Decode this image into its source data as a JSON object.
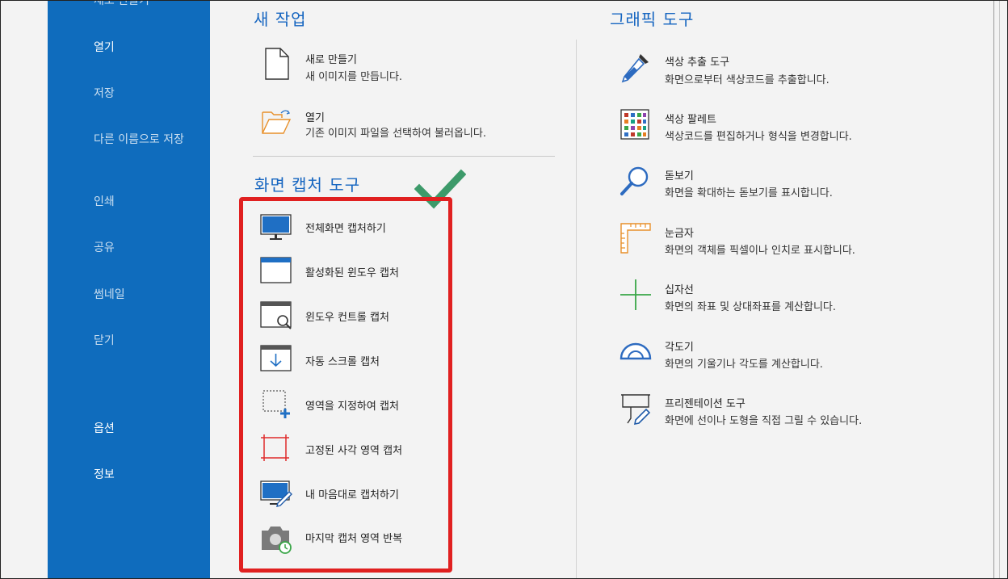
{
  "sidebar": {
    "items": [
      {
        "label": "새로 만들기"
      },
      {
        "label": "열기"
      },
      {
        "label": "저장"
      },
      {
        "label": "다른 이름으로 저장"
      },
      {
        "label": "인쇄"
      },
      {
        "label": "공유"
      },
      {
        "label": "썸네일"
      },
      {
        "label": "닫기"
      },
      {
        "label": "옵션"
      },
      {
        "label": "정보"
      }
    ]
  },
  "new_task": {
    "title": "새 작업",
    "items": [
      {
        "title": "새로 만들기",
        "desc": "새 이미지를 만듭니다."
      },
      {
        "title": "열기",
        "desc": "기존 이미지 파일을 선택하여 불러옵니다."
      }
    ]
  },
  "capture": {
    "title": "화면 캡처 도구",
    "items": [
      {
        "label": "전체화면 캡처하기",
        "icon": "monitor-icon"
      },
      {
        "label": "활성화된 윈도우 캡처",
        "icon": "window-icon"
      },
      {
        "label": "윈도우 컨트롤 캡처",
        "icon": "window-control-icon"
      },
      {
        "label": "자동 스크롤 캡처",
        "icon": "scroll-capture-icon"
      },
      {
        "label": "영역을 지정하여 캡처",
        "icon": "region-select-icon"
      },
      {
        "label": "고정된 사각 영역 캡처",
        "icon": "fixed-rect-icon"
      },
      {
        "label": "내 마음대로 캡처하기",
        "icon": "freeform-capture-icon"
      },
      {
        "label": "마지막 캡처 영역 반복",
        "icon": "repeat-capture-icon"
      }
    ]
  },
  "graphic": {
    "title": "그래픽 도구",
    "items": [
      {
        "title": "색상 추출 도구",
        "desc": "화면으로부터 색상코드를 추출합니다.",
        "icon": "eyedropper-icon"
      },
      {
        "title": "색상 팔레트",
        "desc": "색상코드를 편집하거나 형식을 변경합니다.",
        "icon": "palette-icon"
      },
      {
        "title": "돋보기",
        "desc": "화면을 확대하는 돋보기를 표시합니다.",
        "icon": "magnifier-icon"
      },
      {
        "title": "눈금자",
        "desc": "화면의 객체를 픽셀이나 인치로 표시합니다.",
        "icon": "ruler-icon"
      },
      {
        "title": "십자선",
        "desc": "화면의 좌표 및 상대좌표를 계산합니다.",
        "icon": "crosshair-icon"
      },
      {
        "title": "각도기",
        "desc": "화면의 기울기나 각도를 계산합니다.",
        "icon": "protractor-icon"
      },
      {
        "title": "프리젠테이션 도구",
        "desc": "화면에 선이나 도형을 직접 그릴 수 있습니다.",
        "icon": "presentation-icon"
      }
    ]
  },
  "colors": {
    "sidebar": "#0f6cbd",
    "accent_title": "#1565c0",
    "highlight_box": "#e02020",
    "check_mark": "#3d9a6a"
  }
}
